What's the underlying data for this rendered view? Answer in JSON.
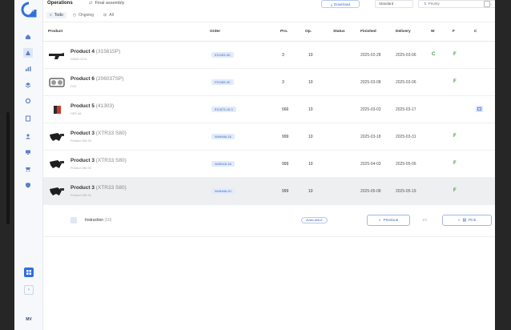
{
  "header": {
    "title": "Operations",
    "subtitle": "Final assembly",
    "tabs": [
      {
        "label": "Todo",
        "icon": "list-icon"
      },
      {
        "label": "Ongoing",
        "icon": "clock-icon"
      },
      {
        "label": "All",
        "icon": "grid-icon"
      }
    ],
    "download_label": "Download",
    "standard_select": "Standard",
    "priority_select": "Priority"
  },
  "table": {
    "columns": [
      "Product",
      "Order",
      "Pro.",
      "Op.",
      "Status",
      "Finished",
      "Delivery",
      "W",
      "F",
      "C"
    ],
    "rows": [
      {
        "name": "Product 4",
        "code": "(315615P)",
        "sub": "DSMS 4Tnx",
        "order": "E11093-3C",
        "pro": "3",
        "op": "10",
        "status": "",
        "finished": "2025-02-28",
        "delivery": "2025-03-06",
        "w": "C",
        "f": "F",
        "c": false,
        "thumb": "gun"
      },
      {
        "name": "Product 6",
        "code": "(206037SP)",
        "sub": "D20",
        "order": "P21183-3C",
        "pro": "3",
        "op": "10",
        "status": "",
        "finished": "2025-03-08",
        "delivery": "2025-03-06",
        "w": "",
        "f": "F",
        "c": false,
        "thumb": "machine"
      },
      {
        "name": "Product 5",
        "code": "(41303)",
        "sub": "HSS 4A",
        "order": "E11873-10.3",
        "pro": "666",
        "op": "10",
        "status": "",
        "finished": "2025-03-03",
        "delivery": "2025-03-17",
        "w": "",
        "f": "",
        "c": true,
        "thumb": "box"
      },
      {
        "name": "Product 3",
        "code": "(XTR33 S80)",
        "sub": "Product 286 33",
        "order": "W49466-16",
        "pro": "999",
        "op": "10",
        "status": "",
        "finished": "2025-03-18",
        "delivery": "2025-03-31",
        "w": "",
        "f": "F",
        "c": false,
        "thumb": "tool"
      },
      {
        "name": "Product 3",
        "code": "(XTR33 S80)",
        "sub": "Product 286 33",
        "order": "W49416-18",
        "pro": "999",
        "op": "10",
        "status": "",
        "finished": "2025-04-03",
        "delivery": "2025-05-05",
        "w": "",
        "f": "F",
        "c": false,
        "thumb": "tool"
      },
      {
        "name": "Product 3",
        "code": "(XTR33 S80)",
        "sub": "Product 286 33",
        "order": "W49466-20",
        "pro": "999",
        "op": "10",
        "status": "",
        "finished": "2025-05-08",
        "delivery": "2025-05-19",
        "w": "",
        "f": "F",
        "c": false,
        "thumb": "tool",
        "selected": true
      }
    ]
  },
  "expanded": {
    "instruction_label": "Instruction",
    "instruction_count": "(10)",
    "status": "AVAILABLE",
    "prev_label": "Previous",
    "page_indicator": "1/1",
    "pick_label": "Pick"
  },
  "sidebar": {
    "icons": [
      "home-icon",
      "dashboard-icon",
      "chart-icon",
      "layers-icon",
      "settings-icon",
      "document-icon",
      "user-icon",
      "monitor-icon",
      "cart-icon",
      "shield-icon"
    ],
    "user_initials": "MV"
  },
  "colors": {
    "accent": "#3a66c4",
    "badge_bg": "#e2ebfa",
    "green": "#3a9a45"
  }
}
